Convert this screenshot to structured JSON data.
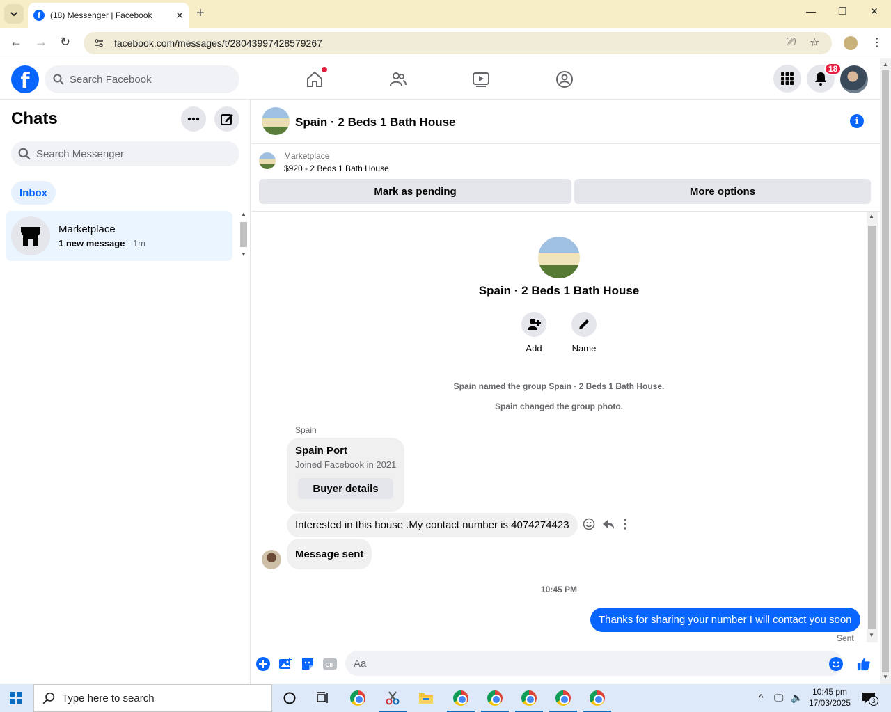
{
  "browser": {
    "tab_title": "(18) Messenger | Facebook",
    "url": "facebook.com/messages/t/28043997428579267"
  },
  "fb": {
    "search_placeholder": "Search Facebook",
    "notification_count": "18"
  },
  "sidebar": {
    "title": "Chats",
    "search_placeholder": "Search Messenger",
    "filter": "Inbox",
    "chats": [
      {
        "name": "Marketplace",
        "preview": "1 new message",
        "time": "· 1m"
      }
    ]
  },
  "conversation": {
    "title": "Spain · 2 Beds 1 Bath House",
    "marketplace_label": "Marketplace",
    "listing": "$920 - 2 Beds 1 Bath House",
    "mark_pending": "Mark as pending",
    "more_options": "More options",
    "group_name": "Spain · 2 Beds 1 Bath House",
    "actions": {
      "add": "Add",
      "name": "Name"
    },
    "system_messages": [
      "Spain named the group Spain · 2 Beds 1 Bath House.",
      "Spain changed the group photo."
    ],
    "sender": "Spain",
    "card": {
      "title": "Spain Port",
      "subtitle": "Joined Facebook in 2021",
      "button": "Buyer details"
    },
    "incoming": [
      "Interested in this house .My contact number is 4074274423",
      "Message sent"
    ],
    "timestamp": "10:45 PM",
    "outgoing": "Thanks for sharing your number I will contact you soon",
    "status": "Sent",
    "composer_placeholder": "Aa"
  },
  "taskbar": {
    "search_placeholder": "Type here to search",
    "time": "10:45 pm",
    "date": "17/03/2025",
    "notification_count": "3"
  }
}
